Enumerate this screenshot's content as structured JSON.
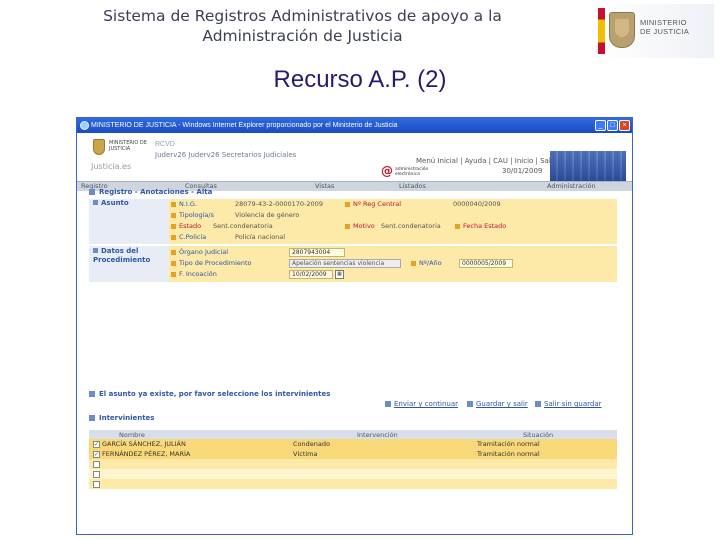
{
  "slide": {
    "title_line1": "Sistema de Registros Administrativos de apoyo a la",
    "title_line2": "Administración de Justicia",
    "subtitle": "Recurso A.P. (2)",
    "logo_line1": "MINISTERIO",
    "logo_line2": "DE JUSTICIA"
  },
  "browser": {
    "title": "MINISTERIO DE JUSTICIA - Windows Internet Explorer proporcionado por el Ministerio de Justicia",
    "min": "_",
    "max": "□",
    "close": "×"
  },
  "app": {
    "crest_text": "MINISTERIO DE JUSTICIA",
    "domain": "Justicia.es",
    "name": "RCVD",
    "user": "Juderv26 Juderv26 Secretarios Judiciales",
    "at_symbol": "@",
    "at_text": "administración electrónica",
    "top_links": "Menú Inicial | Ayuda | CAU | Inicio | Salir",
    "date": "30/01/2009"
  },
  "nav": {
    "tabs": [
      "Registro",
      "Consultas",
      "Vistas",
      "Listados",
      "Administración"
    ]
  },
  "form": {
    "section_title": "Registro - Anotaciones - Alta",
    "asunto": {
      "label": "Asunto",
      "nig_label": "N.I.G.",
      "nig_value": "28079-43-2-0000170-2009",
      "nreg_label": "Nº Reg Central",
      "nreg_value": "0000040/2009",
      "tipologia_label": "Tipología/s",
      "tipologia_value": "Violencia de género",
      "estado_label": "Estado",
      "estado_value": "Sent.condenatoria",
      "motivo_label": "Motivo",
      "motivo_value": "Sent.condenatoria",
      "fecha_estado_label": "Fecha Estado",
      "cpolicia_label": "C.Policía",
      "cpolicia_value": "Policía nacional"
    },
    "procedimiento": {
      "label": "Datos del Procedimiento",
      "organo_label": "Órgano Judicial",
      "organo_value": "2807943004",
      "tipo_label": "Tipo de Procedimiento",
      "tipo_value": "Apelación sentencias violencia",
      "nsano_label": "Nº/Año",
      "nsano_value": "0000005/2009",
      "incoacion_label": "F. Incoación",
      "incoacion_value": "10/02/2009",
      "cal_icon": "▦"
    },
    "actions": {
      "enviar": "Enviar y continuar",
      "guardar": "Guardar y salir",
      "salir": "Salir sin guardar"
    }
  },
  "intervinientes": {
    "title": "Intervinientes",
    "headers": [
      "Nombre",
      "Intervención",
      "Situación"
    ],
    "rows": [
      {
        "nombre": "GARCÍA SÁNCHEZ, JULIÁN",
        "intervencion": "Condenado",
        "situacion": "Tramitación normal",
        "checked": true
      },
      {
        "nombre": "FERNÁNDEZ PÉREZ, MARÍA",
        "intervencion": "Víctima",
        "situacion": "Tramitación normal",
        "checked": true
      },
      {
        "nombre": "",
        "intervencion": "",
        "situacion": "",
        "checked": false
      },
      {
        "nombre": "",
        "intervencion": "",
        "situacion": "",
        "checked": false
      },
      {
        "nombre": "",
        "intervencion": "",
        "situacion": "",
        "checked": false
      }
    ],
    "check_mark": "✓"
  },
  "notice": "El asunto ya existe, por favor seleccione los intervinientes"
}
